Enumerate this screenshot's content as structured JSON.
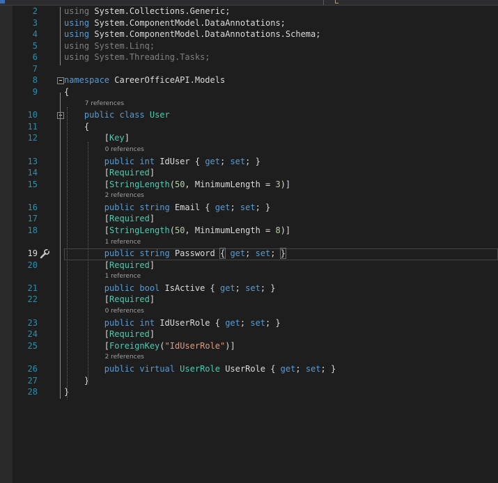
{
  "editor": {
    "lines": [
      {
        "num": "2",
        "parts": [
          {
            "t": "using ",
            "c": "dim"
          },
          {
            "t": "System.Collections.Generic;"
          }
        ]
      },
      {
        "num": "3",
        "parts": [
          {
            "t": "using ",
            "c": "kw"
          },
          {
            "t": "System.ComponentModel.DataAnnotations;"
          }
        ]
      },
      {
        "num": "4",
        "parts": [
          {
            "t": "using ",
            "c": "kw"
          },
          {
            "t": "System.ComponentModel.DataAnnotations.Schema;"
          }
        ]
      },
      {
        "num": "5",
        "parts": [
          {
            "t": "using ",
            "c": "dim"
          },
          {
            "t": "System.Linq;",
            "c": "dim"
          }
        ]
      },
      {
        "num": "6",
        "parts": [
          {
            "t": "using ",
            "c": "dim"
          },
          {
            "t": "System.Threading.Tasks;",
            "c": "dim"
          }
        ]
      },
      {
        "num": "7",
        "parts": []
      },
      {
        "num": "8",
        "parts": [
          {
            "t": "namespace ",
            "c": "kw"
          },
          {
            "t": "CareerOfficeAPI.Models"
          }
        ]
      },
      {
        "num": "9",
        "parts": [
          {
            "t": "{"
          }
        ]
      },
      {
        "lens": "7 references",
        "indent": 1
      },
      {
        "num": "10",
        "parts": [
          {
            "t": "    public ",
            "c": "kw"
          },
          {
            "t": "class ",
            "c": "kw"
          },
          {
            "t": "User",
            "c": "ty"
          }
        ]
      },
      {
        "num": "11",
        "parts": [
          {
            "t": "    {"
          }
        ]
      },
      {
        "num": "12",
        "parts": [
          {
            "t": "        ["
          },
          {
            "t": "Key",
            "c": "ty"
          },
          {
            "t": "]"
          }
        ]
      },
      {
        "lens": "0 references",
        "indent": 2
      },
      {
        "num": "13",
        "parts": [
          {
            "t": "        public ",
            "c": "kw"
          },
          {
            "t": "int ",
            "c": "kw"
          },
          {
            "t": "IdUser { "
          },
          {
            "t": "get",
            "c": "kw"
          },
          {
            "t": "; "
          },
          {
            "t": "set",
            "c": "kw"
          },
          {
            "t": "; }"
          }
        ]
      },
      {
        "num": "14",
        "parts": [
          {
            "t": "        ["
          },
          {
            "t": "Required",
            "c": "ty"
          },
          {
            "t": "]"
          }
        ]
      },
      {
        "num": "15",
        "parts": [
          {
            "t": "        ["
          },
          {
            "t": "StringLength",
            "c": "ty"
          },
          {
            "t": "("
          },
          {
            "t": "50",
            "c": "num"
          },
          {
            "t": ", MinimumLength = "
          },
          {
            "t": "3",
            "c": "num"
          },
          {
            "t": ")]"
          }
        ]
      },
      {
        "lens": "2 references",
        "indent": 2
      },
      {
        "num": "16",
        "parts": [
          {
            "t": "        public ",
            "c": "kw"
          },
          {
            "t": "string ",
            "c": "kw"
          },
          {
            "t": "Email { "
          },
          {
            "t": "get",
            "c": "kw"
          },
          {
            "t": "; "
          },
          {
            "t": "set",
            "c": "kw"
          },
          {
            "t": "; }"
          }
        ]
      },
      {
        "num": "17",
        "parts": [
          {
            "t": "        ["
          },
          {
            "t": "Required",
            "c": "ty"
          },
          {
            "t": "]"
          }
        ]
      },
      {
        "num": "18",
        "parts": [
          {
            "t": "        ["
          },
          {
            "t": "StringLength",
            "c": "ty"
          },
          {
            "t": "("
          },
          {
            "t": "50",
            "c": "num"
          },
          {
            "t": ", MinimumLength = "
          },
          {
            "t": "8",
            "c": "num"
          },
          {
            "t": ")]"
          }
        ]
      },
      {
        "lens": "1 reference",
        "indent": 2
      },
      {
        "num": "19",
        "active": true,
        "parts": [
          {
            "t": "        public ",
            "c": "kw"
          },
          {
            "t": "string ",
            "c": "kw"
          },
          {
            "t": "Password "
          },
          {
            "t": "{",
            "hl": true
          },
          {
            "t": " "
          },
          {
            "t": "get",
            "c": "kw"
          },
          {
            "t": "; "
          },
          {
            "t": "set",
            "c": "kw"
          },
          {
            "t": "; "
          },
          {
            "t": "}",
            "hl": true
          }
        ]
      },
      {
        "num": "20",
        "parts": [
          {
            "t": "        ["
          },
          {
            "t": "Required",
            "c": "ty"
          },
          {
            "t": "]"
          }
        ]
      },
      {
        "lens": "1 reference",
        "indent": 2
      },
      {
        "num": "21",
        "parts": [
          {
            "t": "        public ",
            "c": "kw"
          },
          {
            "t": "bool ",
            "c": "kw"
          },
          {
            "t": "IsActive { "
          },
          {
            "t": "get",
            "c": "kw"
          },
          {
            "t": "; "
          },
          {
            "t": "set",
            "c": "kw"
          },
          {
            "t": "; }"
          }
        ]
      },
      {
        "num": "22",
        "parts": [
          {
            "t": "        ["
          },
          {
            "t": "Required",
            "c": "ty"
          },
          {
            "t": "]"
          }
        ]
      },
      {
        "lens": "0 references",
        "indent": 2
      },
      {
        "num": "23",
        "parts": [
          {
            "t": "        public ",
            "c": "kw"
          },
          {
            "t": "int ",
            "c": "kw"
          },
          {
            "t": "IdUserRole { "
          },
          {
            "t": "get",
            "c": "kw"
          },
          {
            "t": "; "
          },
          {
            "t": "set",
            "c": "kw"
          },
          {
            "t": "; }"
          }
        ]
      },
      {
        "num": "24",
        "parts": [
          {
            "t": "        ["
          },
          {
            "t": "Required",
            "c": "ty"
          },
          {
            "t": "]"
          }
        ]
      },
      {
        "num": "25",
        "parts": [
          {
            "t": "        ["
          },
          {
            "t": "ForeignKey",
            "c": "ty"
          },
          {
            "t": "("
          },
          {
            "t": "\"IdUserRole\"",
            "c": "str"
          },
          {
            "t": ")]"
          }
        ]
      },
      {
        "lens": "2 references",
        "indent": 2
      },
      {
        "num": "26",
        "parts": [
          {
            "t": "        public ",
            "c": "kw"
          },
          {
            "t": "virtual ",
            "c": "kw"
          },
          {
            "t": "UserRole",
            "c": "ty"
          },
          {
            "t": " UserRole { "
          },
          {
            "t": "get",
            "c": "kw"
          },
          {
            "t": "; "
          },
          {
            "t": "set",
            "c": "kw"
          },
          {
            "t": "; }"
          }
        ]
      },
      {
        "num": "27",
        "parts": [
          {
            "t": "    }"
          }
        ]
      },
      {
        "num": "28",
        "parts": [
          {
            "t": "}"
          }
        ]
      }
    ]
  },
  "icons": {
    "fold_10": "collapse-icon",
    "fold_8": "collapse-icon",
    "line19_marker": "quick-actions-wrench-icon"
  },
  "colors": {
    "background": "#1e1e1e",
    "keyword": "#569cd6",
    "type": "#4ec9b0",
    "number": "#b5cea8",
    "string": "#d69d85",
    "line_number": "#2b91af"
  }
}
